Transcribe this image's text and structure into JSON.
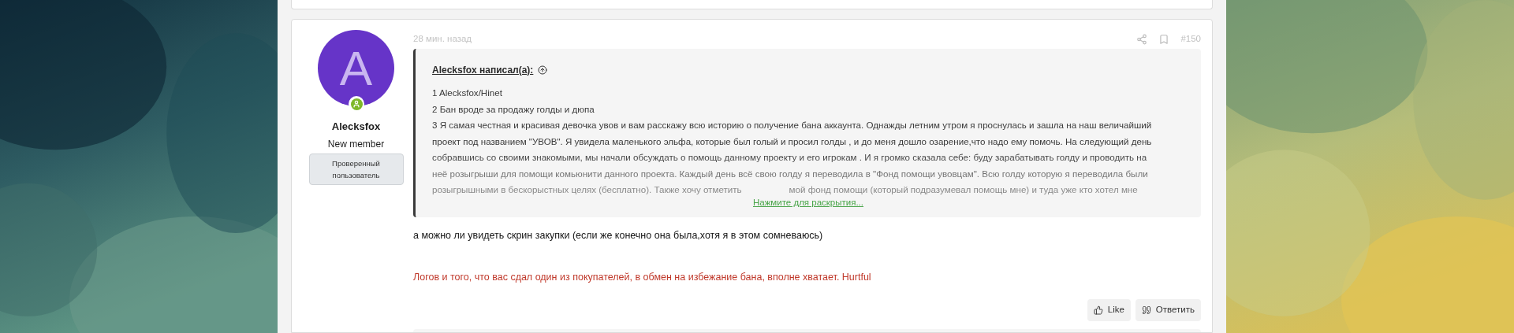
{
  "post": {
    "time": "28 мин. назад",
    "number": "#150",
    "author": {
      "initial": "A",
      "name": "Alecksfox",
      "title": "New member",
      "banner": "Проверенный пользователь",
      "online": true
    },
    "quote": {
      "author": "Alecksfox написал(а):",
      "lines": [
        "1 Alecksfox/Hinet",
        "2 Бан вроде за продажу голды и дюпа",
        "3 Я самая честная и красивая девочка увов и вам расскажу всю историю о получение бана аккаунта. Однажды летним утром я проснулась и зашла на наш величайший",
        "проект под названием \"УВОВ\". Я увидела маленького эльфа, которые был голый и просил голды , и до меня дошло озарение,что надо ему помочь. На следующий день",
        "собравшись со своими знакомыми, мы начали обсуждать о помощь данному проекту и его игрокам . И я громко сказала себе: буду зарабатывать голду и проводить на",
        "неё розыгрыши для помощи комьюнити данного проекта. Каждый день всё свою голду я переводила в \"Фонд помощи увовцам\". Всю голду которую я переводила были"
      ],
      "cut_line": [
        "розыгрышными в бескорыстных целях (бесплатно). Также хочу отметить",
        "мой фонд помощи (который подразумевал помощь мне) и туда уже кто хотел мне"
      ],
      "expand_link": "Нажмите для раскрытия..."
    },
    "body": [
      {
        "kind": "plain",
        "text": "а можно ли увидеть скрин закупки (если же конечно она была,хотя я в этом сомневаюсь)"
      },
      {
        "kind": "red",
        "text": "Логов и того, что вас сдал один из покупателей, в обмен на избежание бана, вполне хватает. Hurtful"
      }
    ],
    "actions": [
      {
        "kind": "like",
        "label": "Like"
      },
      {
        "kind": "reply",
        "label": "Ответить"
      }
    ]
  }
}
